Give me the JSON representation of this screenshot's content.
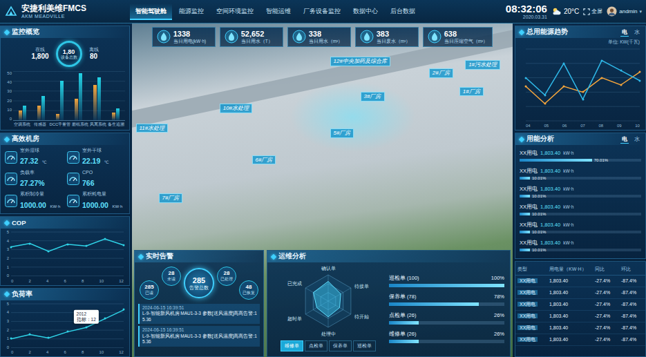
{
  "header": {
    "logo": "安捷利美维FMCS",
    "logo_sub": "AKM MEADVILLE",
    "nav": [
      {
        "label": "智能驾驶舱",
        "selected": true
      },
      {
        "label": "能源监控",
        "selected": false
      },
      {
        "label": "空间环境监控",
        "selected": false
      },
      {
        "label": "智能运维",
        "selected": false
      },
      {
        "label": "厂务设备监控",
        "selected": false
      },
      {
        "label": "数据中心",
        "selected": false
      },
      {
        "label": "后台数据",
        "selected": false
      }
    ],
    "time": "08:32:06",
    "date": "2020.03.31",
    "weather": "20°C",
    "fullscreen": "全屏",
    "user": "andmin",
    "caret": "▾"
  },
  "kpis": [
    {
      "value": "1338",
      "label": "当日用电(kW·h)"
    },
    {
      "value": "52,652",
      "label": "当日用水（T）"
    },
    {
      "value": "338",
      "label": "当日用水（m³）"
    },
    {
      "value": "383",
      "label": "当日废水（m³）"
    },
    {
      "value": "638",
      "label": "当日压缩空气（m³）"
    }
  ],
  "map_labels": [
    "12#中央加药及综合库",
    "2#厂房",
    "1#厂房",
    "3#厂房",
    "1#污水处理",
    "10#水处理",
    "11#水处理",
    "5#厂房",
    "6#厂房",
    "7#厂房"
  ],
  "overview": {
    "title": "监控概览",
    "online": {
      "label": "在线",
      "value": "1,800"
    },
    "total": {
      "value": "1,80",
      "label": "设备总数"
    },
    "offline": {
      "label": "离线",
      "value": "80"
    },
    "chart": {
      "ticks": [
        "50",
        "40",
        "30",
        "20",
        "10",
        "0"
      ],
      "max": 50,
      "categories": [
        "空调系统",
        "传感器",
        "DCC千量管",
        "磨纸系统",
        "风离系统",
        "备生追溯"
      ],
      "series": [
        {
          "values": [
            10,
            15,
            6,
            22,
            36,
            8
          ],
          "color": "#f4a53c"
        },
        {
          "values": [
            15,
            25,
            40,
            48,
            44,
            12
          ],
          "color": "#22d3e6"
        }
      ]
    }
  },
  "machine_room": {
    "title": "高效机房",
    "items": [
      {
        "label": "室外湿球",
        "value": "27.32",
        "unit": "℃"
      },
      {
        "label": "室外干球",
        "value": "22.19",
        "unit": "℃"
      },
      {
        "label": "负载率",
        "value": "27.27%"
      },
      {
        "label": "CPO",
        "value": "766"
      },
      {
        "label": "累积制冷量",
        "value": "1000.00",
        "unit": "KW·h"
      },
      {
        "label": "累积耗电量",
        "value": "1000.00",
        "unit": "KW·h"
      }
    ]
  },
  "cop": {
    "title": "COP",
    "y_ticks": [
      "5",
      "4",
      "3",
      "2",
      "1",
      "0"
    ],
    "x_ticks": [
      "0",
      "2",
      "4",
      "6",
      "8",
      "10",
      "12"
    ],
    "max": 5,
    "values": [
      3.3,
      3.7,
      2.8,
      3.6,
      3.4,
      4.2,
      3.5
    ]
  },
  "load": {
    "title": "负荷率",
    "y_ticks": [
      "5",
      "4",
      "3",
      "2",
      "1",
      "0"
    ],
    "x_ticks": [
      "0",
      "2",
      "4",
      "6",
      "8",
      "10",
      "12"
    ],
    "max": 5,
    "values": [
      1.0,
      1.5,
      1.1,
      1.8,
      2.3,
      3.3,
      4.3
    ],
    "tooltip": {
      "point": 4,
      "title": "2012",
      "text": "指标：12"
    }
  },
  "alarms": {
    "title": "实时告警",
    "total": {
      "value": "285",
      "label": "告警总数"
    },
    "stats": [
      {
        "value": "285",
        "label": "已读"
      },
      {
        "value": "28",
        "label": "未读"
      },
      {
        "value": "28",
        "label": "已处理"
      },
      {
        "value": "48",
        "label": "已恢复"
      }
    ],
    "entries": [
      {
        "time": "2024-06-15 16:39:51",
        "text": "L-9-智能新风机房 MAU1-3-3 参数[送风温度]高高告警:15.36"
      },
      {
        "time": "2024-06-15 16:39:51",
        "text": "L-9-智能新风机房 MAU1-3-3 参数[送风温度]高高告警:15.36"
      }
    ]
  },
  "ops": {
    "title": "运维分析",
    "radar": {
      "axes": [
        "确认单",
        "待接单",
        "待开始",
        "处理中",
        "超时单",
        "已完成"
      ],
      "values": [
        0.75,
        0.55,
        0.5,
        0.6,
        0.5,
        0.65
      ]
    },
    "bars": [
      {
        "label": "巡检单 (100)",
        "pct": "100%",
        "level": 1
      },
      {
        "label": "保养单 (78)",
        "pct": "78%",
        "level": 0.78
      },
      {
        "label": "点检单 (26)",
        "pct": "26%",
        "level": 0.26
      },
      {
        "label": "维修单 (26)",
        "pct": "26%",
        "level": 0.26
      }
    ],
    "tabs": [
      {
        "label": "维修单",
        "selected": true
      },
      {
        "label": "点检单",
        "selected": false
      },
      {
        "label": "保养单",
        "selected": false
      },
      {
        "label": "巡检单",
        "selected": false
      }
    ]
  },
  "trend": {
    "title": "总用能源趋势",
    "tabs": [
      {
        "label": "电",
        "selected": true
      },
      {
        "label": "水",
        "selected": false
      }
    ],
    "unit": "单位: KW(千瓦)",
    "x_ticks": [
      "04",
      "05",
      "06",
      "07",
      "08",
      "09",
      "10"
    ],
    "max": 50,
    "series": [
      {
        "values": [
          24,
          12,
          24,
          20,
          30,
          25,
          34
        ],
        "color": "#f4a53c"
      },
      {
        "values": [
          30,
          18,
          40,
          15,
          42,
          35,
          28
        ],
        "color": "#2fb8e8"
      }
    ]
  },
  "analysis": {
    "title": "用能分析",
    "tabs": [
      {
        "label": "电",
        "selected": true
      },
      {
        "label": "水",
        "selected": false
      }
    ],
    "items": [
      {
        "name": "XX用电",
        "value": "1,803.40",
        "unit": "kW·h",
        "pct": "70.01%",
        "level": 0.7001
      },
      {
        "name": "XX用电",
        "value": "1,803.40",
        "unit": "kW·h",
        "pct": "10.01%",
        "level": 0.1001
      },
      {
        "name": "XX用电",
        "value": "1,803.40",
        "unit": "kW·h",
        "pct": "10.01%",
        "level": 0.1001
      },
      {
        "name": "XX用电",
        "value": "1,803.40",
        "unit": "kW·h",
        "pct": "10.01%",
        "level": 0.1001
      },
      {
        "name": "XX用电",
        "value": "1,803.40",
        "unit": "kW·h",
        "pct": "10.01%",
        "level": 0.1001
      },
      {
        "name": "XX用电",
        "value": "1,803.40",
        "unit": "kW·h",
        "pct": "10.01%",
        "level": 0.1001
      }
    ]
  },
  "table": {
    "columns": [
      "类型",
      "用电量（KW·H）",
      "同比",
      "环比"
    ],
    "rows": [
      [
        "XX用电",
        "1,803.40",
        "-27.4%",
        "-87.4%"
      ],
      [
        "XX用电",
        "1,803.40",
        "-27.4%",
        "-87.4%"
      ],
      [
        "XX用电",
        "1,803.40",
        "-27.4%",
        "-87.4%"
      ],
      [
        "XX用电",
        "1,803.40",
        "-27.4%",
        "-87.4%"
      ],
      [
        "XX用电",
        "1,803.40",
        "-27.4%",
        "-87.4%"
      ],
      [
        "XX用电",
        "1,803.40",
        "-27.4%",
        "-87.4%"
      ]
    ]
  }
}
